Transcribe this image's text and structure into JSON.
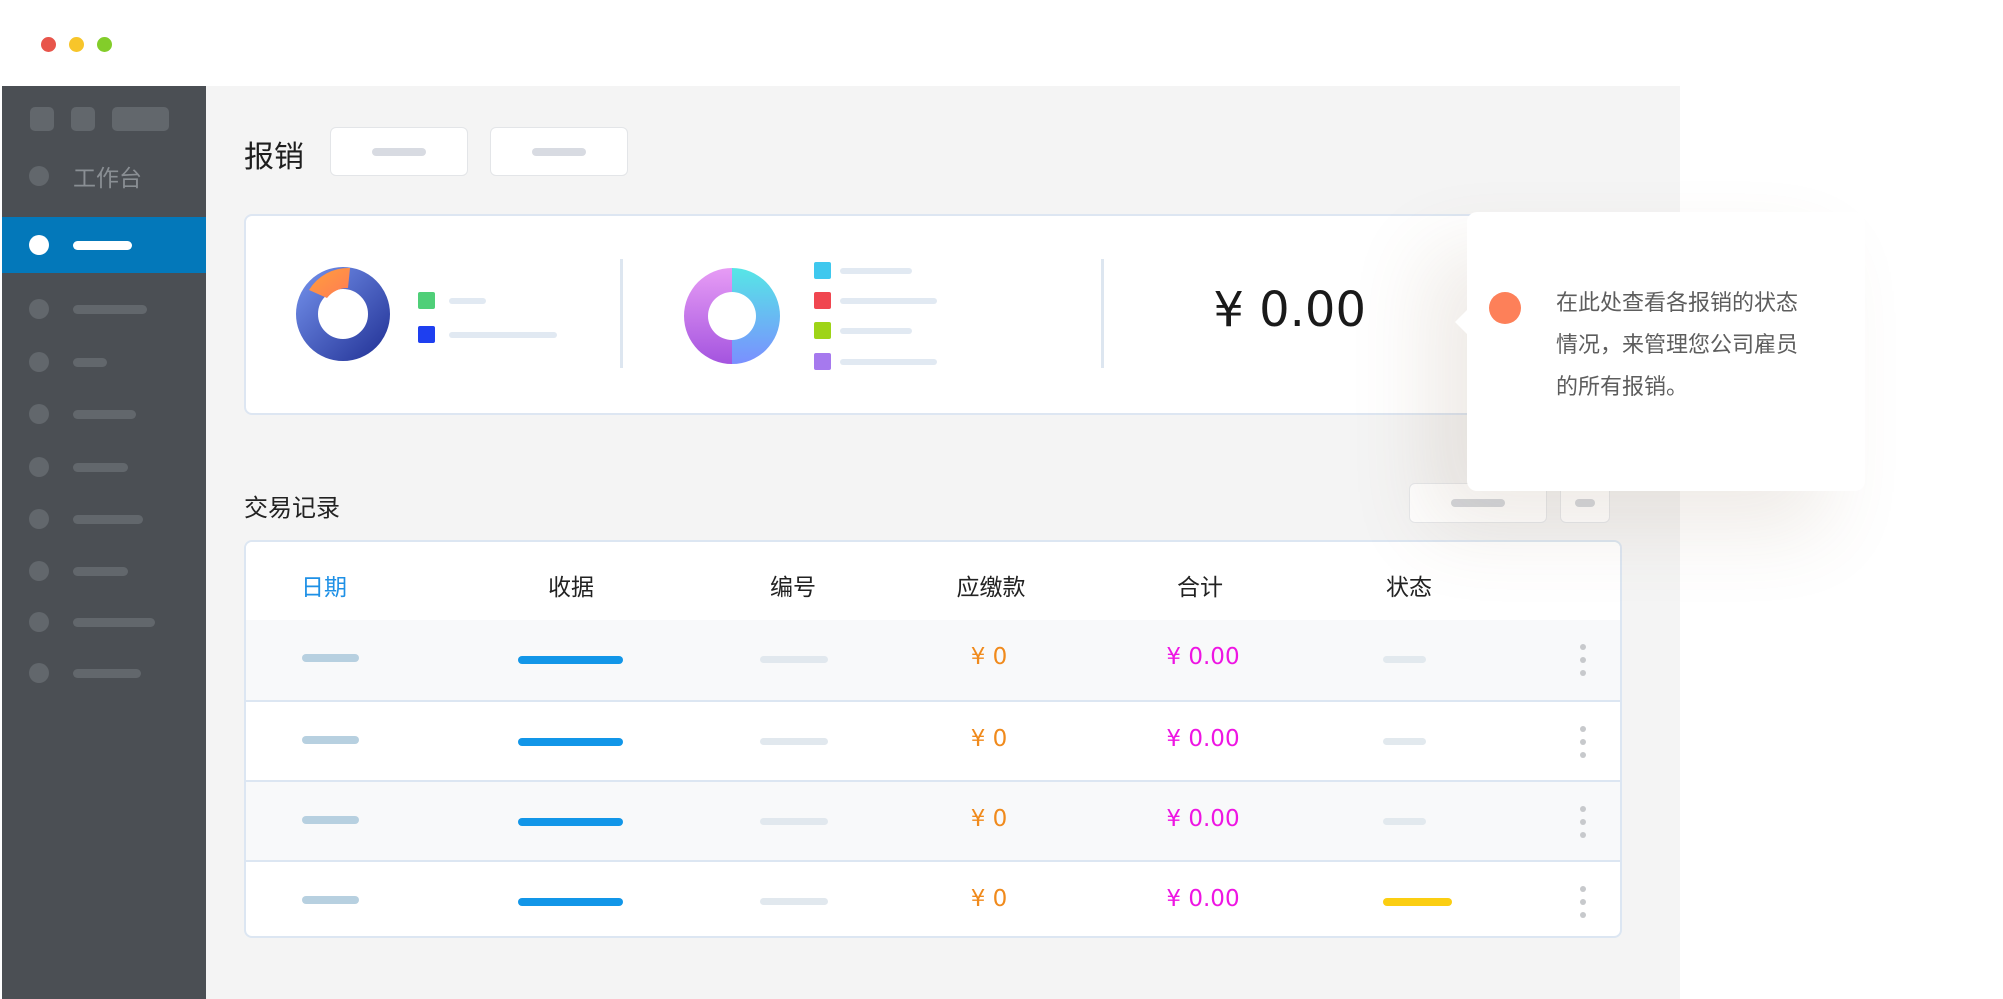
{
  "window": {
    "controls": [
      {
        "name": "close",
        "color": "#e8554b"
      },
      {
        "name": "minimize",
        "color": "#f7c52a"
      },
      {
        "name": "zoom",
        "color": "#83cd2a"
      }
    ]
  },
  "sidebar": {
    "workbench_label": "工作台",
    "colors": {
      "background": "#4b4f54",
      "active": "#0378ba"
    }
  },
  "header": {
    "title": "报销"
  },
  "summary": {
    "total": "¥ 0.00"
  },
  "transactions": {
    "title": "交易记录",
    "columns": [
      "日期",
      "收据",
      "编号",
      "应缴款",
      "合计",
      "状态"
    ],
    "rows": [
      {
        "due": "¥ 0",
        "total": "¥ 0.00"
      },
      {
        "due": "¥ 0",
        "total": "¥ 0.00"
      },
      {
        "due": "¥ 0",
        "total": "¥ 0.00"
      },
      {
        "due": "¥ 0",
        "total": "¥ 0.00"
      }
    ]
  },
  "tooltip": {
    "text": "在此处查看各报销的状态情况，来管理您公司雇员的所有报销。",
    "accent": "#fd8059"
  }
}
